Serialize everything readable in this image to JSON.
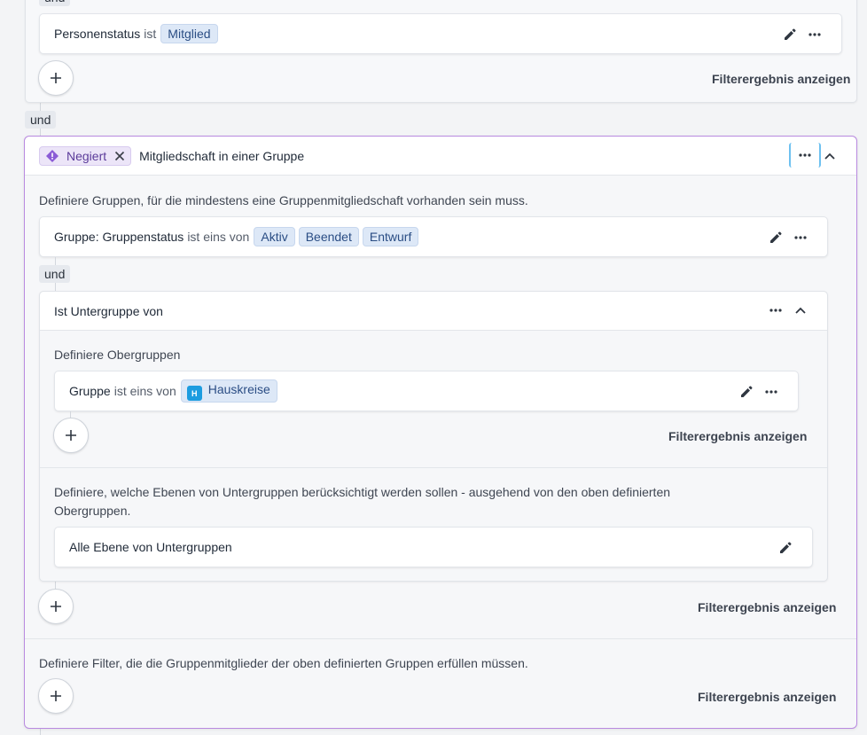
{
  "colors": {
    "accent_purple": "#a86bd6",
    "chip_bg": "#dde8f7",
    "chip_text": "#2a4d84",
    "group_icon": "#1c9ce0"
  },
  "top_card": {
    "partial_label": "und",
    "condition": {
      "field": "Personenstatus",
      "operator": "ist",
      "values": [
        "Mitglied"
      ]
    },
    "show_result": "Filterergebnis anzeigen"
  },
  "connector_und_1": "und",
  "membership": {
    "negated_label": "Negiert",
    "title": "Mitgliedschaft in einer Gruppe",
    "groups_description": "Definiere Gruppen, für die mindestens eine Gruppenmitgliedschaft vorhanden sein muss.",
    "group_condition": {
      "field": "Gruppe: Gruppenstatus",
      "operator": "ist eins von",
      "values": [
        "Aktiv",
        "Beendet",
        "Entwurf"
      ]
    },
    "connector_und": "und",
    "subgroup": {
      "title": "Ist Untergruppe von",
      "parents_description": "Definiere Obergruppen",
      "parent_condition": {
        "field": "Gruppe",
        "operator": "ist eins von",
        "icon_letter": "H",
        "value": "Hauskreise"
      },
      "parents_show_result": "Filterergebnis anzeigen",
      "levels_description_line1": "Definiere, welche Ebenen von Untergruppen berücksichtigt werden sollen - ausgehend von den oben definierten",
      "levels_description_line2": "Obergruppen.",
      "levels_value": "Alle Ebene von Untergruppen"
    },
    "groups_show_result": "Filterergebnis anzeigen",
    "members_description": "Definiere Filter, die die Gruppenmitglieder der oben definierten Gruppen erfüllen müssen.",
    "members_show_result": "Filterergebnis anzeigen"
  }
}
